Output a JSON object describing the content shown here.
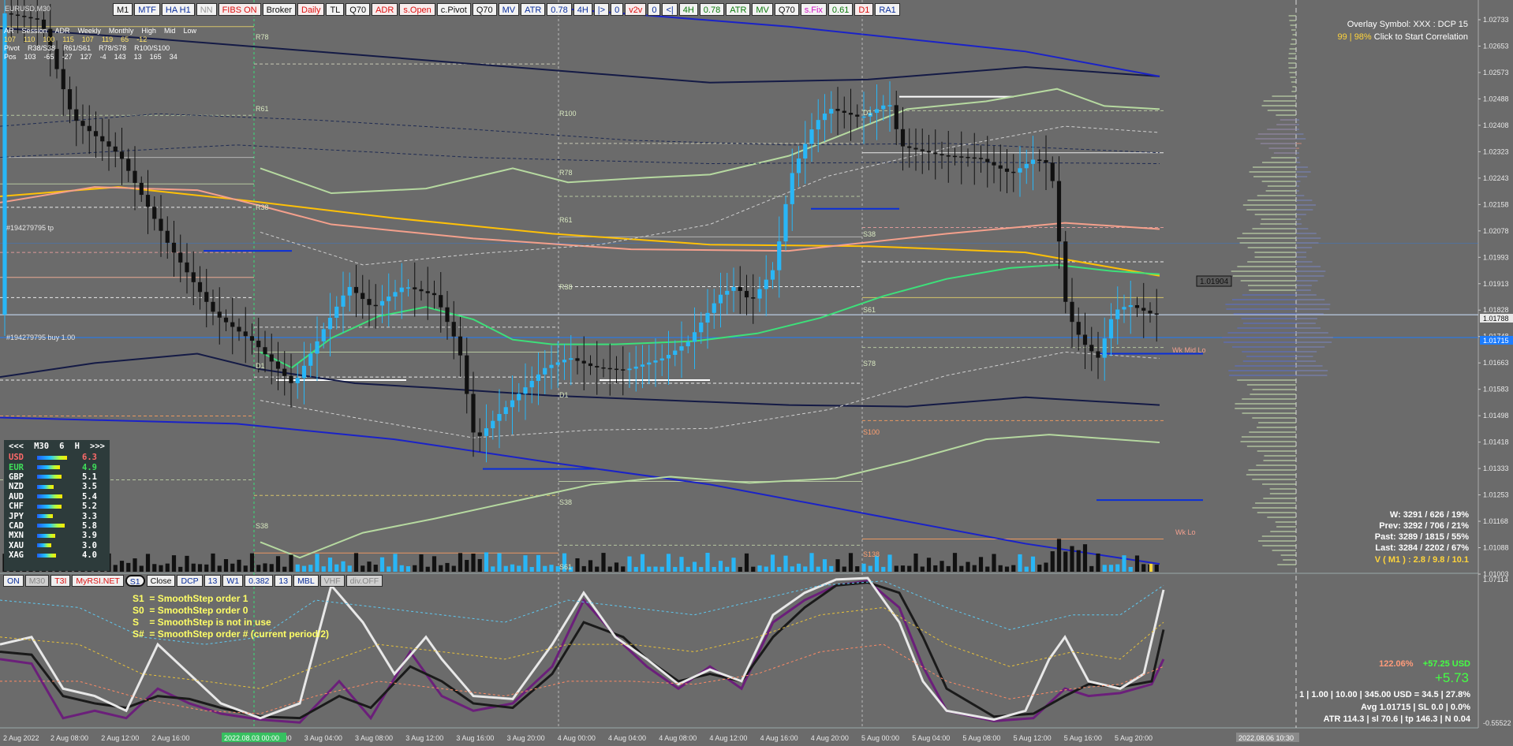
{
  "window": {
    "symbol_label": "EURUSD,M30"
  },
  "toolbar": {
    "buttons": [
      "M1",
      "MTF",
      "HA H1",
      "NN",
      "FIBS ON",
      "Broker",
      "Daily",
      "TL",
      "Q70",
      "ADR",
      "s.Open",
      "c.Pivot",
      "Q70",
      "MV",
      "ATR",
      "0.78",
      "4H",
      "|>",
      "0",
      "v2v",
      "0",
      "<|",
      "4H",
      "0.78",
      "ATR",
      "MV",
      "Q70",
      "s.Fix",
      "0.61",
      "D1",
      "RA1"
    ]
  },
  "info_panel": {
    "row1": [
      "AR",
      "Session",
      "ADR",
      "Weekly",
      "Monthly",
      "High",
      "Mid",
      "Low"
    ],
    "row2": [
      "107",
      "110",
      "100",
      "115",
      "107",
      "119",
      "65",
      "-12"
    ],
    "row3": [
      "Pivot",
      "R38/S38",
      "R61/S61",
      "R78/S78",
      "R100/S100"
    ],
    "row4": [
      "Pos",
      "103",
      "-65",
      "-27",
      "127",
      "-4",
      "143",
      "13",
      "165",
      "34"
    ]
  },
  "overlay": {
    "line1": "Overlay Symbol: XXX : DCP 15",
    "line2_prefix": "99 | 98%",
    "line2_suffix": "Click to Start Correlation"
  },
  "price_axis": [
    "1.02733",
    "1.02653",
    "1.02573",
    "1.02488",
    "1.02408",
    "1.02323",
    "1.02243",
    "1.02158",
    "1.02078",
    "1.01993",
    "1.01913",
    "1.01828",
    "1.01748",
    "1.01663",
    "1.01583",
    "1.01498",
    "1.01418",
    "1.01333",
    "1.01253",
    "1.01168",
    "1.01088",
    "1.01003"
  ],
  "price_tags": {
    "current": "1.01788",
    "buy": "1.01715",
    "drag_label": "1.01904"
  },
  "chart_labels": {
    "tp_order": "#194279795 tp",
    "buy_order": "#194279795 buy 1.00",
    "wk_mid": "Wk Mid Lo",
    "wk_lo": "Wk Lo",
    "levels_left": [
      "R78",
      "R61",
      "R38",
      "D1",
      "S38"
    ],
    "levels_mid": [
      "R100",
      "R78",
      "R61",
      "R38",
      "D1",
      "S38",
      "S61"
    ],
    "levels_right": [
      "D1",
      "S38",
      "S61",
      "S78",
      "S100",
      "S138"
    ]
  },
  "stats": {
    "w": "W: 3291 / 626 / 19%",
    "prev": "Prev: 3292 / 706 / 21%",
    "past": "Past: 3289 / 1815 / 55%",
    "last": "Last: 3284 / 2202 / 67%",
    "vol": "V ( M1 ) : 2.8 / 9.8 / 10.1"
  },
  "strength": {
    "header": [
      "<<<",
      "M30",
      "6",
      "H",
      ">>>"
    ],
    "rows": [
      {
        "cur": "USD",
        "val": "6.3",
        "level": 0.63,
        "color": "#ff6a6a"
      },
      {
        "cur": "EUR",
        "val": "4.9",
        "level": 0.49,
        "color": "#3fe05a"
      },
      {
        "cur": "GBP",
        "val": "5.1",
        "level": 0.51,
        "color": "#ffffff"
      },
      {
        "cur": "NZD",
        "val": "3.5",
        "level": 0.35,
        "color": "#ffffff"
      },
      {
        "cur": "AUD",
        "val": "5.4",
        "level": 0.54,
        "color": "#ffffff"
      },
      {
        "cur": "CHF",
        "val": "5.2",
        "level": 0.52,
        "color": "#ffffff"
      },
      {
        "cur": "JPY",
        "val": "3.3",
        "level": 0.33,
        "color": "#ffffff"
      },
      {
        "cur": "CAD",
        "val": "5.8",
        "level": 0.58,
        "color": "#ffffff"
      },
      {
        "cur": "MXN",
        "val": "3.9",
        "level": 0.39,
        "color": "#ffffff"
      },
      {
        "cur": "XAU",
        "val": "3.0",
        "level": 0.3,
        "color": "#ffffff"
      },
      {
        "cur": "XAG",
        "val": "4.0",
        "level": 0.4,
        "color": "#ffffff"
      }
    ]
  },
  "sub_toolbar": {
    "buttons": [
      "ON",
      "M30",
      "T3I",
      "MyRSI.NET",
      "S1",
      "Close",
      "DCP",
      "13",
      "W1",
      "0.382",
      "13",
      "MBL",
      "VHF",
      "div.OFF"
    ]
  },
  "smoothstep_note": [
    "S1  = SmoothStep order 1",
    "S0  = SmoothStep order 0",
    "S    = SmoothStep is not in use",
    "S#  = SmoothStep order # (current period/2)"
  ],
  "indicator_axis": {
    "top": "1.07114",
    "bottom": "-0.55522"
  },
  "account": {
    "pct": "122.06%",
    "usd": "+57.25 USD",
    "big": "+5.73",
    "line1": "1  |  1.00  |  10.00  |  345.00 USD = 34.5  |  27.8%",
    "line2": "Avg 1.01715  |  SL 0.0  |  0.0%",
    "line3": "ATR 114.3  |  sl 70.6  |  tp 146.3  |  N 0.04"
  },
  "time_axis": [
    "2 Aug 2022",
    "2 Aug 08:00",
    "2 Aug 12:00",
    "2 Aug 16:00",
    "2 Aug 20:00",
    "3 Aug 04:00",
    "3 Aug 08:00",
    "3 Aug 12:00",
    "3 Aug 16:00",
    "3 Aug 20:00",
    "4 Aug 00:00",
    "4 Aug 04:00",
    "4 Aug 08:00",
    "4 Aug 12:00",
    "4 Aug 16:00",
    "4 Aug 20:00",
    "5 Aug 00:00",
    "5 Aug 04:00",
    "5 Aug 08:00",
    "5 Aug 12:00",
    "5 Aug 16:00",
    "5 Aug 20:00"
  ],
  "time_highlight": {
    "left": "2022.08.03 00:00",
    "right": "2022.08.06 10:30"
  },
  "colors": {
    "background": "#6b6b6b",
    "bull": "#29b6f6",
    "bear": "#111111",
    "axis_text": "#e8e8e8"
  }
}
